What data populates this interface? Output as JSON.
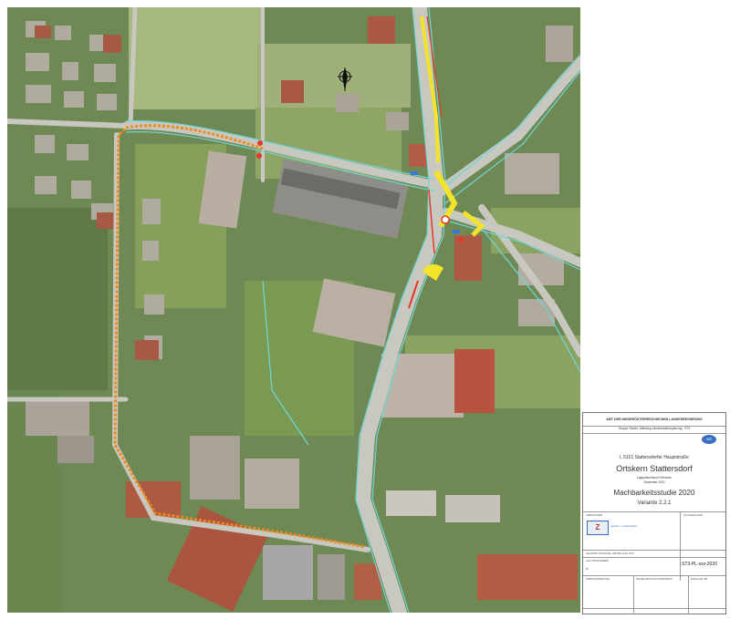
{
  "titleblock": {
    "authority": "AMT DER NIEDERÖSTERREICHISCHEN LANDESREGIERUNG",
    "department": "Gruppe Straße, Abteilung Landesstraßenplanung - ST3",
    "road": "L 5101 Stattersdorfer Hauptstraße",
    "project": "Ortskern Stattersdorf",
    "plan_type": "Lageplanentwurf Orthofoto",
    "date": "Dezember 2020",
    "study": "Machbarkeitsstudie 2020",
    "variant": "Variante 2.2.1",
    "plan_number": "ST3-PL-xxx-2020",
    "index": "A",
    "logo_text": "NÖ",
    "firm": "verkehr + infrastruktur",
    "field_labels": {
      "verfasser": "VERFASSER",
      "planzeichen": "PLANZEICHEN",
      "auftraggeber": "AUFTRAGGEBER",
      "planinhalt": "PLANINHALT",
      "gruppe": "GRUPPE STRASSE, ABTEILUNG ST3",
      "index_label": "INDEXÄNDERUNG",
      "genehmigung": "GENEHMIGUNGSVERMERK",
      "einlage": "EINLAGE NR."
    }
  },
  "colors": {
    "road": "#c9c9c3",
    "path": "#f08a1c",
    "building_roof": "#b7b3aa",
    "red_roof": "#b5533f",
    "green": "#7d9a5c",
    "dark_green": "#4e6b38",
    "cyan_line": "#6fd6d6",
    "yellow_mark": "#f3e32a"
  }
}
